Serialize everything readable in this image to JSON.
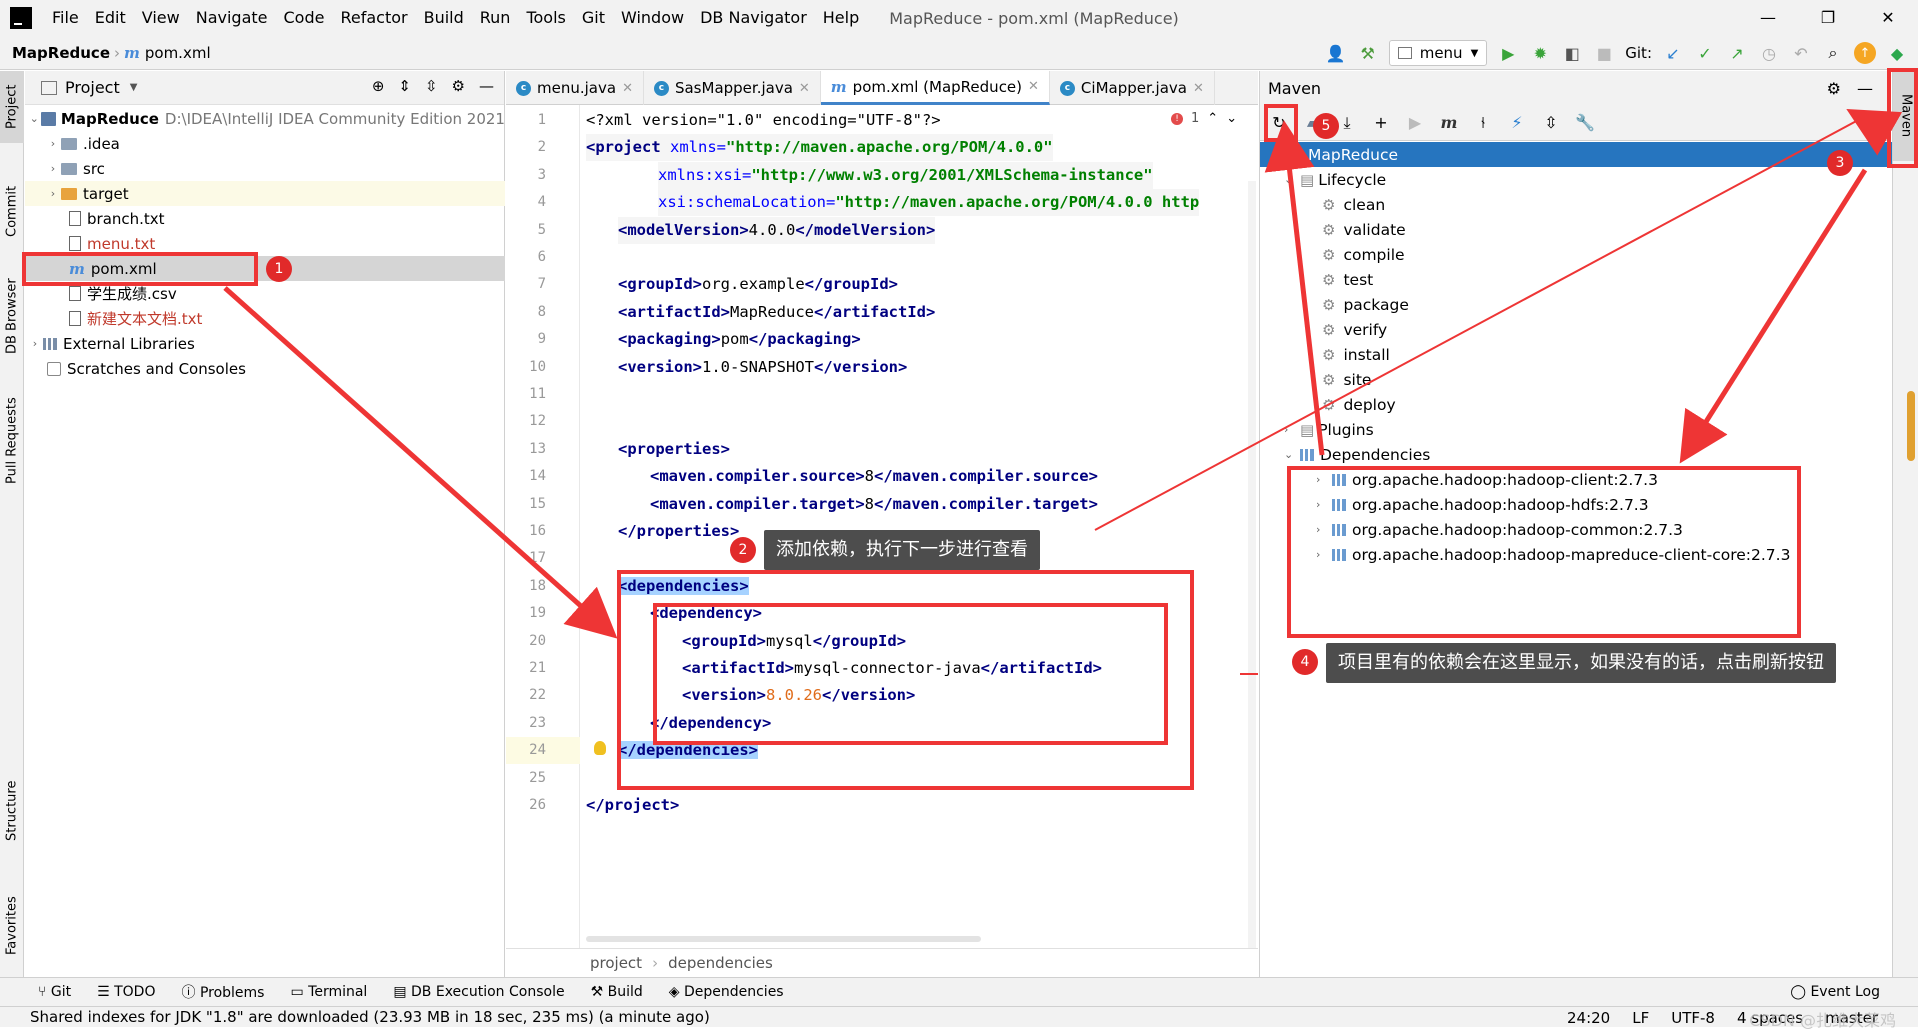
{
  "window": {
    "title": "MapReduce - pom.xml (MapReduce)",
    "menu": [
      "File",
      "Edit",
      "View",
      "Navigate",
      "Code",
      "Refactor",
      "Build",
      "Run",
      "Tools",
      "Git",
      "Window",
      "DB Navigator",
      "Help"
    ],
    "controls": [
      "—",
      "❐",
      "✕"
    ]
  },
  "navbar": {
    "project": "MapReduce",
    "file": "pom.xml",
    "run_config": "menu",
    "git_label": "Git:"
  },
  "left_strip": [
    "Project",
    "Commit",
    "DB Browser",
    "Pull Requests",
    "Structure",
    "Favorites"
  ],
  "project_panel": {
    "title": "Project",
    "tree": [
      {
        "label": "MapReduce",
        "extra": "D:\\IDEA\\IntelliJ IDEA Community Edition 2021"
      },
      {
        "label": ".idea"
      },
      {
        "label": "src"
      },
      {
        "label": "target"
      },
      {
        "label": "branch.txt"
      },
      {
        "label": "menu.txt"
      },
      {
        "label": "pom.xml"
      },
      {
        "label": "学生成绩.csv"
      },
      {
        "label": "新建文本文档.txt"
      },
      {
        "label": "External Libraries"
      },
      {
        "label": "Scratches and Consoles"
      }
    ]
  },
  "editor": {
    "tabs": [
      "menu.java",
      "SasMapper.java",
      "pom.xml (MapReduce)",
      "CiMapper.java"
    ],
    "error_count": "1",
    "breadcrumb": [
      "project",
      "dependencies"
    ],
    "lines": [
      "1",
      "2",
      "3",
      "4",
      "5",
      "6",
      "7",
      "8",
      "9",
      "10",
      "11",
      "12",
      "13",
      "14",
      "15",
      "16",
      "17",
      "18",
      "19",
      "20",
      "21",
      "22",
      "23",
      "24",
      "25",
      "26"
    ],
    "code": {
      "l1": "<?xml version=\"1.0\" encoding=\"UTF-8\"?>",
      "l2_tag": "<project",
      "l2_attr": " xmlns=",
      "l2_val": "\"http://maven.apache.org/POM/4.0.0\"",
      "l3_attr": "xmlns:xsi=",
      "l3_val": "\"http://www.w3.org/2001/XMLSchema-instance\"",
      "l4_attr": "xsi:schemaLocation=",
      "l4_val": "\"http://maven.apache.org/POM/4.0.0 http",
      "l5": "modelVersion",
      "l5v": "4.0.0",
      "l7": "groupId",
      "l7v": "org.example",
      "l8": "artifactId",
      "l8v": "MapReduce",
      "l9": "packaging",
      "l9v": "pom",
      "l10": "version",
      "l10v": "1.0-SNAPSHOT",
      "l13": "properties",
      "l14": "maven.compiler.source",
      "l14v": "8",
      "l15": "maven.compiler.target",
      "l15v": "8",
      "l16": "properties",
      "l18": "dependencies",
      "l19": "dependency",
      "l20": "groupId",
      "l20v": "mysql",
      "l21": "artifactId",
      "l21v": "mysql-connector-java",
      "l22": "version",
      "l22v": "8.0.26",
      "l23": "dependency",
      "l24": "dependencies",
      "l26": "project"
    }
  },
  "maven": {
    "title": "Maven",
    "root": "MapReduce",
    "lifecycle": "Lifecycle",
    "phases": [
      "clean",
      "validate",
      "compile",
      "test",
      "package",
      "verify",
      "install",
      "site",
      "deploy"
    ],
    "plugins": "Plugins",
    "dependencies": "Dependencies",
    "deps": [
      "org.apache.hadoop:hadoop-client:2.7.3",
      "org.apache.hadoop:hadoop-hdfs:2.7.3",
      "org.apache.hadoop:hadoop-common:2.7.3",
      "org.apache.hadoop:hadoop-mapreduce-client-core:2.7.3"
    ]
  },
  "right_strip": [
    "Maven"
  ],
  "bottom_tools": [
    "Git",
    "TODO",
    "Problems",
    "Terminal",
    "DB Execution Console",
    "Build",
    "Dependencies",
    "Event Log"
  ],
  "status": {
    "message": "Shared indexes for JDK \"1.8\" are downloaded (23.93 MB in 18 sec, 235 ms) (a minute ago)",
    "position": "24:20",
    "line_sep": "LF",
    "encoding": "UTF-8",
    "indent": "4 spaces",
    "branch": "master",
    "watermark": "CSDN @扎维大菜鸡"
  },
  "annotations": {
    "b1": "1",
    "b2": "2",
    "b3": "3",
    "b4": "4",
    "b5": "5",
    "c2": "添加依赖，执行下一步进行查看",
    "c4": "项目里有的依赖会在这里显示，如果没有的话，点击刷新按钮"
  },
  "colors": {
    "annotation_red": "#ee3535",
    "selection_blue": "#2675bf",
    "callout_bg": "#4d4d4d"
  }
}
